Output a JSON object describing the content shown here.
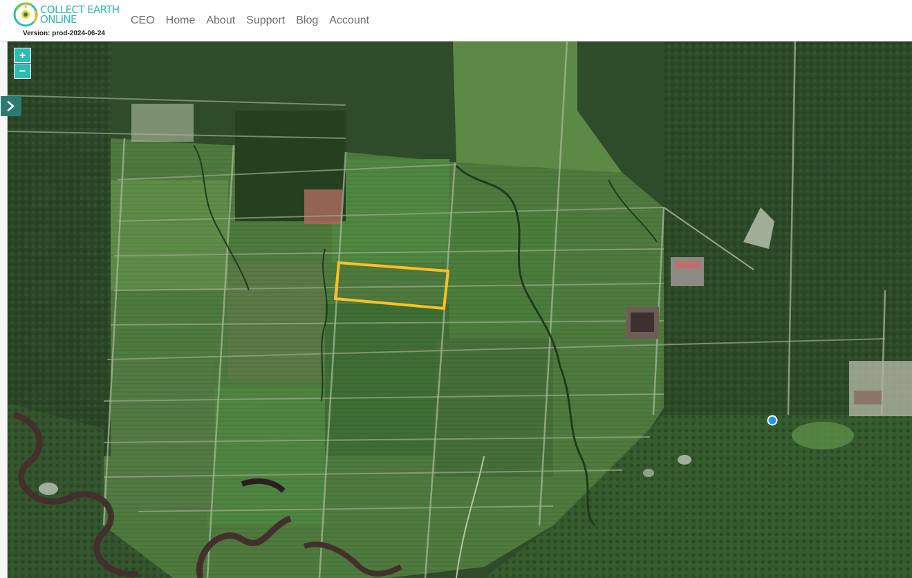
{
  "app": {
    "logo_line1": "COLLECT EARTH",
    "logo_line2": "ONLINE",
    "version": "Version: prod-2024-06-24"
  },
  "nav": {
    "items": [
      "CEO",
      "Home",
      "About",
      "Support",
      "Blog",
      "Account"
    ]
  },
  "map": {
    "zoom_in_label": "+",
    "zoom_out_label": "−",
    "basemap": "satellite imagery of oil palm plantation blocks, forest and a meandering river",
    "plot_outline_color": "#fbbf24",
    "point_marker_color": "#2196f3"
  },
  "colors": {
    "brand": "#31bab0",
    "panel_toggle": "#2a7b72",
    "nav_text": "#6c6c6c"
  },
  "icons": {
    "panel_toggle": "chevron-right-icon",
    "logo": "globe-logo-icon"
  }
}
